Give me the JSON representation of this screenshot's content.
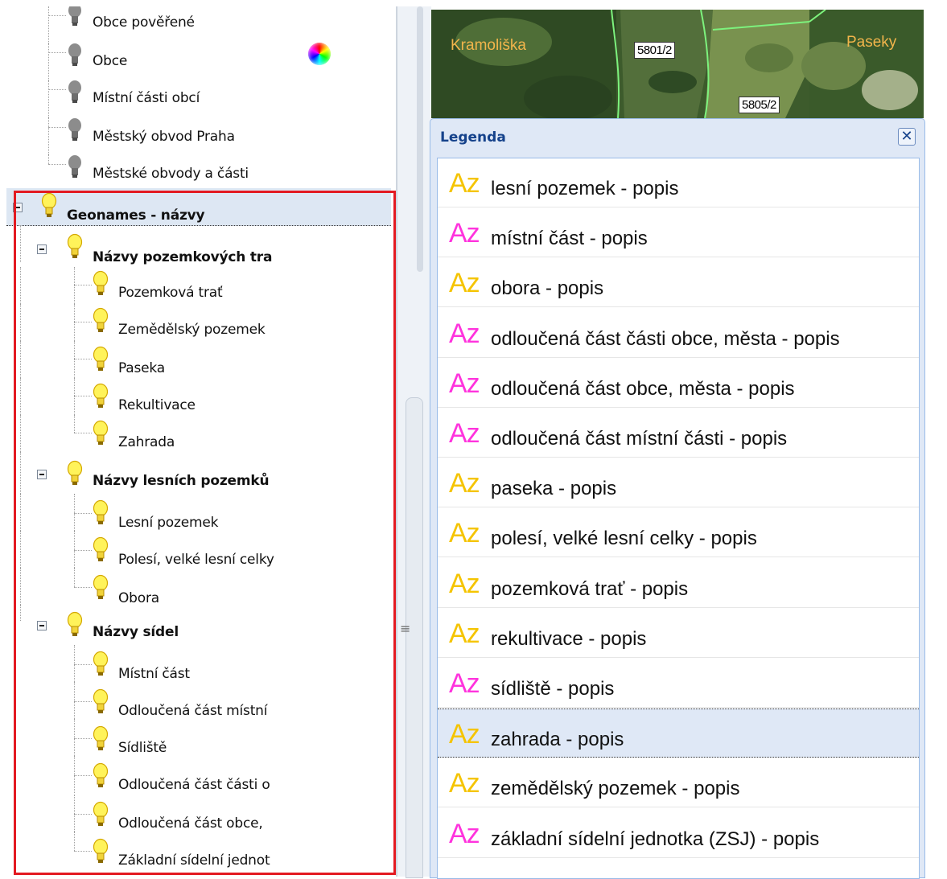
{
  "tree": {
    "top_items": [
      {
        "label": "Obce pověřené"
      },
      {
        "label": "Obce"
      },
      {
        "label": "Místní části obcí"
      },
      {
        "label": "Městský obvod Praha"
      },
      {
        "label": "Městské obvody a části"
      }
    ],
    "group": {
      "label": "Geonames - názvy",
      "subgroups": [
        {
          "label": "Názvy pozemkových tra",
          "items": [
            {
              "label": "Pozemková trať"
            },
            {
              "label": "Zemědělský pozemek"
            },
            {
              "label": "Paseka"
            },
            {
              "label": "Rekultivace"
            },
            {
              "label": "Zahrada"
            }
          ]
        },
        {
          "label": "Názvy lesních pozemků",
          "items": [
            {
              "label": "Lesní pozemek"
            },
            {
              "label": "Polesí, velké lesní celky"
            },
            {
              "label": "Obora"
            }
          ]
        },
        {
          "label": "Názvy sídel",
          "items": [
            {
              "label": "Místní část"
            },
            {
              "label": "Odloučená část místní"
            },
            {
              "label": "Sídliště"
            },
            {
              "label": "Odloučená část části o"
            },
            {
              "label": "Odloučená část obce,"
            },
            {
              "label": "Základní sídelní jednot"
            }
          ]
        }
      ]
    }
  },
  "map": {
    "place_labels": [
      "Kramoliška",
      "Paseky"
    ],
    "parcel_labels": [
      "5801/2",
      "5805/2"
    ]
  },
  "splitter": {
    "grip": "≡"
  },
  "legend": {
    "title": "Legenda",
    "close_glyph": "✕",
    "items": [
      {
        "az": "Az",
        "color": "#f5c400",
        "text": "lesní pozemek - popis"
      },
      {
        "az": "Az",
        "color": "#ff33dd",
        "text": "místní část - popis"
      },
      {
        "az": "Az",
        "color": "#f5c400",
        "text": "obora - popis"
      },
      {
        "az": "Az",
        "color": "#ff33dd",
        "text": "odloučená část části obce, města - popis"
      },
      {
        "az": "Az",
        "color": "#ff33dd",
        "text": "odloučená část obce, města - popis"
      },
      {
        "az": "Az",
        "color": "#ff33dd",
        "text": "odloučená část místní části - popis"
      },
      {
        "az": "Az",
        "color": "#f5c400",
        "text": "paseka - popis"
      },
      {
        "az": "Az",
        "color": "#f5c400",
        "text": "polesí, velké lesní celky - popis"
      },
      {
        "az": "Az",
        "color": "#f5c400",
        "text": "pozemková trať - popis"
      },
      {
        "az": "Az",
        "color": "#f5c400",
        "text": "rekultivace - popis"
      },
      {
        "az": "Az",
        "color": "#ff33dd",
        "text": "sídliště - popis"
      },
      {
        "az": "Az",
        "color": "#f5c400",
        "text": "zahrada - popis",
        "selected": true
      },
      {
        "az": "Az",
        "color": "#f5c400",
        "text": "zemědělský pozemek - popis"
      },
      {
        "az": "Az",
        "color": "#ff33dd",
        "text": "základní sídelní jednotka (ZSJ) - popis"
      }
    ]
  },
  "colors": {
    "selection": "#dde7f3",
    "highlight_border": "#e31a21",
    "legend_header": "#15428b"
  }
}
